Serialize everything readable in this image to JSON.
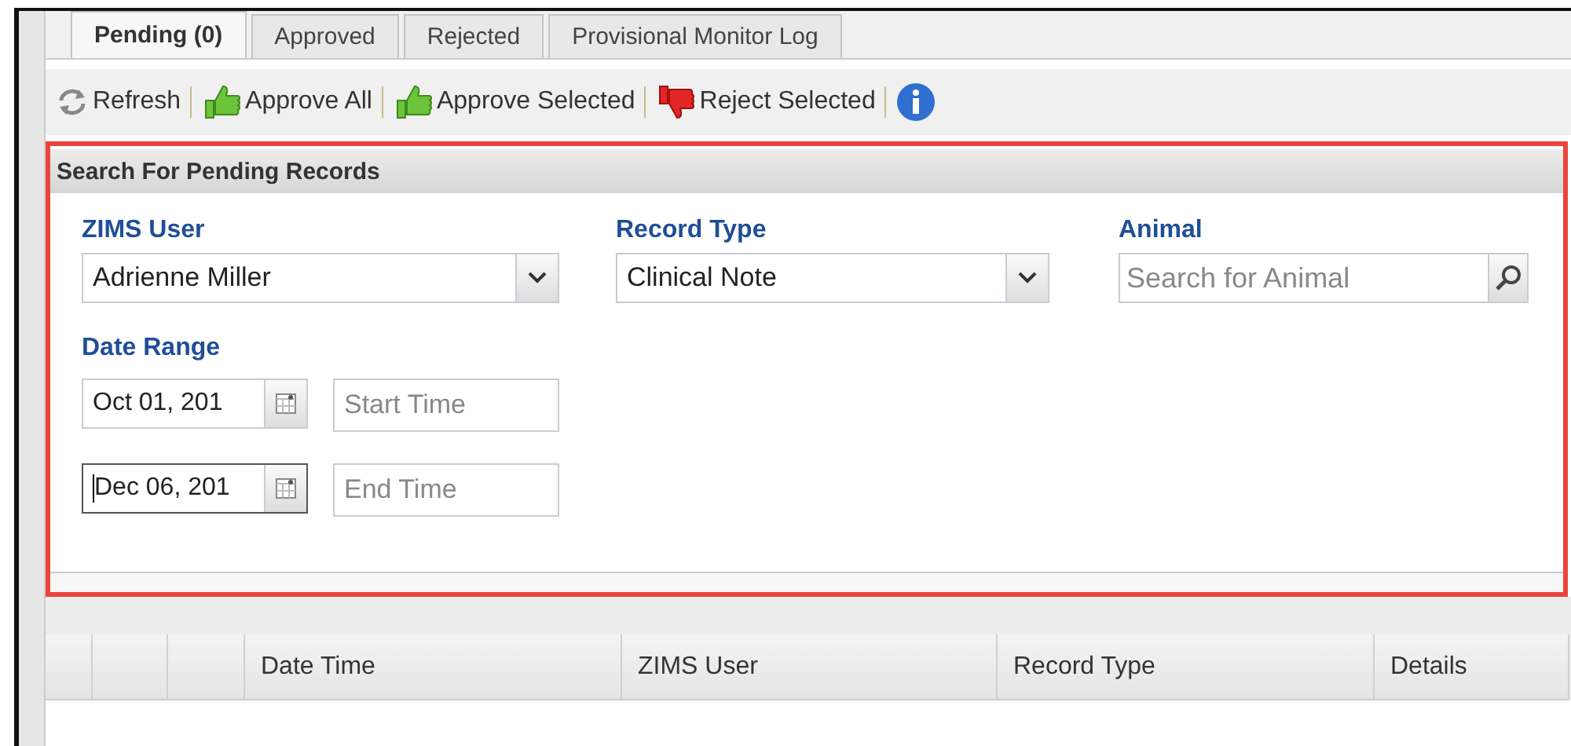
{
  "tabs": [
    {
      "label": "Pending (0)",
      "selected": true
    },
    {
      "label": "Approved",
      "selected": false
    },
    {
      "label": "Rejected",
      "selected": false
    },
    {
      "label": "Provisional Monitor Log",
      "selected": false
    }
  ],
  "toolbar": [
    {
      "kind": "refresh",
      "label": "Refresh"
    },
    {
      "kind": "approve",
      "label": "Approve All"
    },
    {
      "kind": "approve",
      "label": "Approve Selected"
    },
    {
      "kind": "reject",
      "label": "Reject Selected"
    },
    {
      "kind": "info"
    }
  ],
  "search_panel": {
    "title": "Search For Pending Records",
    "zims_user": {
      "label": "ZIMS User",
      "value": "Adrienne Miller"
    },
    "record_type": {
      "label": "Record Type",
      "value": "Clinical Note"
    },
    "animal": {
      "label": "Animal",
      "placeholder": "Search for Animal"
    },
    "date_range": {
      "label": "Date Range",
      "rows": [
        {
          "date": "Oct 01, 201",
          "time_placeholder": "Start Time",
          "focused": false
        },
        {
          "date": "Dec 06, 201",
          "time_placeholder": "End Time",
          "focused": true
        }
      ]
    }
  },
  "grid": {
    "columns": [
      "",
      "",
      "",
      "Date Time",
      "ZIMS User",
      "Record Type",
      "Details"
    ]
  }
}
